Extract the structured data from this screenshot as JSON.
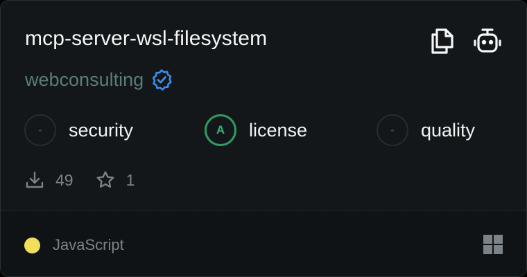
{
  "card": {
    "title": "mcp-server-wsl-filesystem",
    "author": "webconsulting",
    "verified": true,
    "actions": [
      {
        "icon": "copy-icon"
      },
      {
        "icon": "robot-icon"
      }
    ],
    "metrics": [
      {
        "grade": "-",
        "label": "security",
        "status": "none"
      },
      {
        "grade": "A",
        "label": "license",
        "status": "good"
      },
      {
        "grade": "-",
        "label": "quality",
        "status": "none"
      }
    ],
    "stats": {
      "downloads": "49",
      "stars": "1"
    },
    "footer": {
      "language": "JavaScript",
      "language_color": "#f1df5a",
      "platform_icon": "windows-icon"
    }
  },
  "colors": {
    "background": "#131719",
    "author": "#5a7d79",
    "grade_good": "#34b574",
    "verified_badge": "#3b8ff0"
  }
}
